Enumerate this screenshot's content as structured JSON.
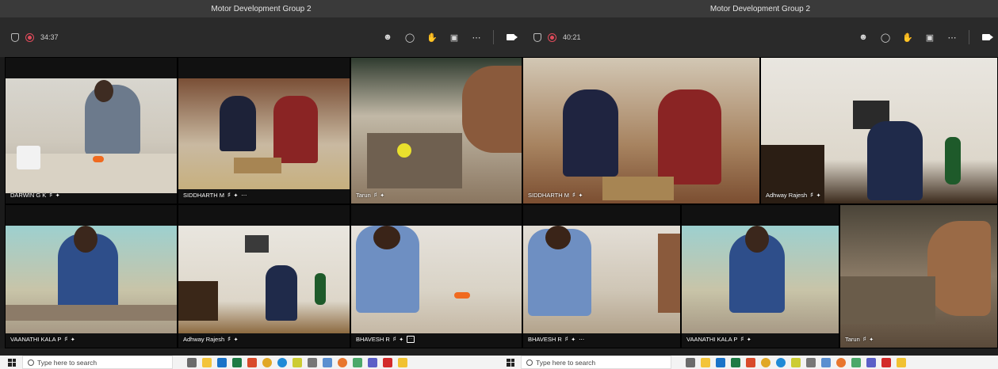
{
  "left_window": {
    "title": "Motor Development Group 2",
    "timer": "34:37",
    "participants": [
      {
        "name": "DARWIN G K",
        "has_more": false
      },
      {
        "name": "SIDDHARTH M",
        "has_more": true
      },
      {
        "name": "Tarun",
        "has_more": false
      },
      {
        "name": "VAANATHI KALA P",
        "has_more": false
      },
      {
        "name": "Adhway Rajesh",
        "has_more": false
      },
      {
        "name": "BHAVESH R",
        "has_more": false
      }
    ]
  },
  "right_window": {
    "title": "Motor Development Group 2",
    "timer": "40:21",
    "participants": [
      {
        "name": "SIDDHARTH M",
        "has_more": false
      },
      {
        "name": "Adhway Rajesh",
        "has_more": false
      },
      {
        "name": "BHAVESH R",
        "has_more": true
      },
      {
        "name": "VAANATHI KALA P",
        "has_more": false
      },
      {
        "name": "Tarun",
        "has_more": false
      }
    ]
  },
  "toolbar_icons": [
    "participants-icon",
    "chat-icon",
    "reactions-icon",
    "share-icon",
    "more-icon",
    "camera-icon"
  ],
  "taskbar": {
    "search_placeholder": "Type here to search",
    "pinned_apps": [
      {
        "name": "task-view-icon",
        "color": "#6b6b6b"
      },
      {
        "name": "file-explorer-icon",
        "color": "#f3c43b"
      },
      {
        "name": "outlook-icon",
        "color": "#1a73c8"
      },
      {
        "name": "excel-icon",
        "color": "#1e7b45"
      },
      {
        "name": "app-red-icon",
        "color": "#d94b2b"
      },
      {
        "name": "chrome-icon",
        "color": "#e1a826"
      },
      {
        "name": "edge-icon",
        "color": "#1f8ad6"
      },
      {
        "name": "pen-icon",
        "color": "#cccc33"
      },
      {
        "name": "settings-icon",
        "color": "#777777"
      },
      {
        "name": "photos-icon",
        "color": "#5a8fd0"
      },
      {
        "name": "firefox-icon",
        "color": "#e8762d"
      },
      {
        "name": "paint-icon",
        "color": "#4ba86a"
      },
      {
        "name": "teams-icon",
        "color": "#5b5fc7"
      },
      {
        "name": "acrobat-icon",
        "color": "#d32a2a"
      },
      {
        "name": "weather-icon",
        "color": "#f1c232"
      }
    ]
  }
}
